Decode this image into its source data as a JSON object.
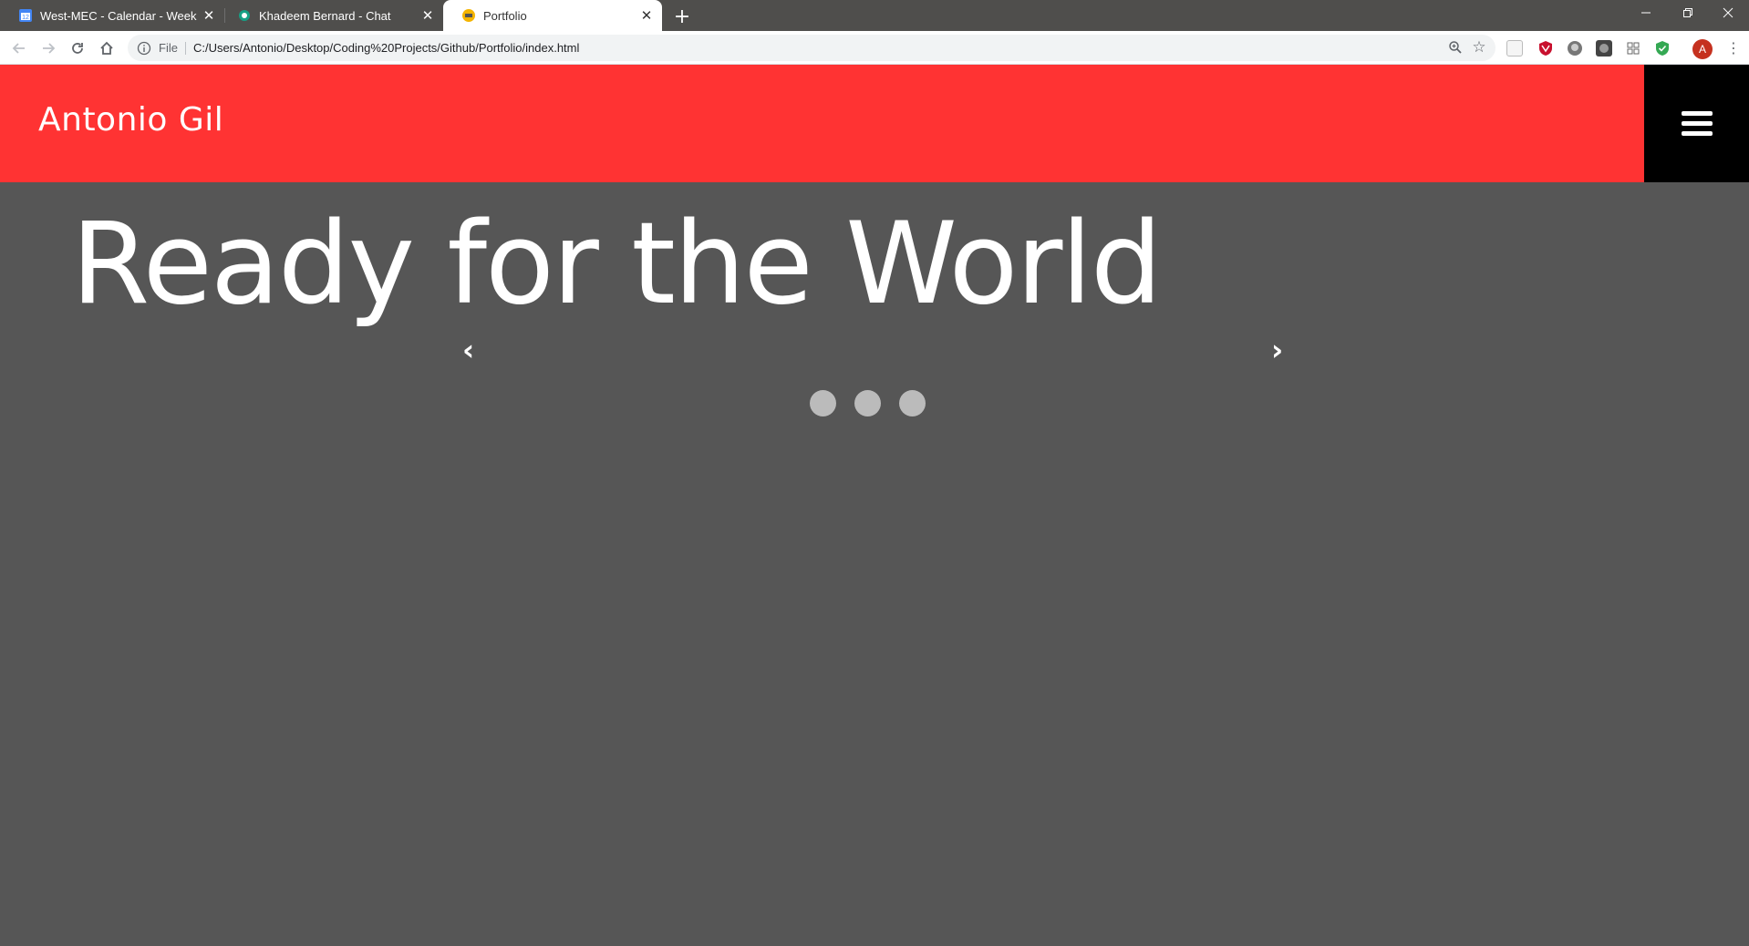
{
  "browser": {
    "tabs": [
      {
        "title": "West-MEC - Calendar - Week of",
        "favicon": "calendar-icon",
        "favicon_text": "12",
        "active": false
      },
      {
        "title": "Khadeem Bernard - Chat",
        "favicon": "chat-icon",
        "active": false
      },
      {
        "title": "Portfolio",
        "favicon": "portfolio-icon",
        "active": true
      }
    ],
    "close_glyph": "✕",
    "new_tab_glyph": "+",
    "omnibox": {
      "scheme_label": "File",
      "url": "C:/Users/Antonio/Desktop/Coding%20Projects/Github/Portfolio/index.html"
    },
    "profile_initial": "A"
  },
  "site": {
    "brand": "Antonio Gil",
    "hero_title": "Ready for the World",
    "carousel": {
      "prev": "‹",
      "next": "›",
      "slide_count": 3
    }
  },
  "colors": {
    "nav_bg": "#ff3333",
    "menu_bg": "#000000",
    "page_bg": "#565656",
    "dot": "#bbbbbb"
  }
}
